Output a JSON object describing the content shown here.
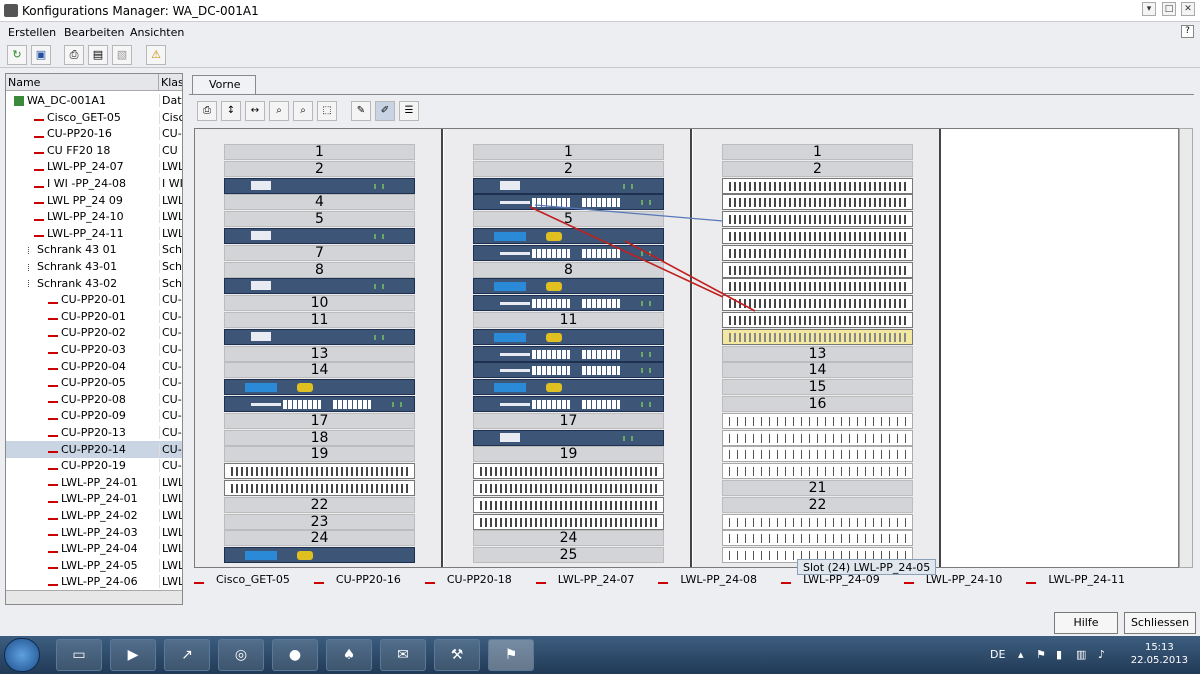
{
  "window": {
    "title": "Konfigurations Manager: WA_DC-001A1"
  },
  "menu": {
    "erstellen": "Erstellen",
    "bearbeiten": "Bearbeiten",
    "ansichten": "Ansichten",
    "help": "?"
  },
  "tree": {
    "col_name": "Name",
    "col_class": "Klas",
    "rows": [
      {
        "name": "WA_DC-001A1",
        "cls": "Dato"
      },
      {
        "name": "Cisco_GET-05",
        "cls": "Cisco"
      },
      {
        "name": "CU-PP20-16",
        "cls": "CU-"
      },
      {
        "name": "CU FF20 18",
        "cls": "CU"
      },
      {
        "name": "LWL-PP_24-07",
        "cls": "LWL"
      },
      {
        "name": "I WI -PP_24-08",
        "cls": "I WI"
      },
      {
        "name": "LWL PP_24 09",
        "cls": "LWL"
      },
      {
        "name": "LWL-PP_24-10",
        "cls": "LWL"
      },
      {
        "name": "LWL-PP_24-11",
        "cls": "LWL"
      },
      {
        "name": "Schrank 43 01",
        "cls": "Schr"
      },
      {
        "name": "Schrank 43-01",
        "cls": "Schr"
      },
      {
        "name": "Schrank 43-02",
        "cls": "Schr"
      },
      {
        "name": "CU-PP20-01",
        "cls": "CU-"
      },
      {
        "name": "CU-PP20-01",
        "cls": "CU-"
      },
      {
        "name": "CU-PP20-02",
        "cls": "CU-"
      },
      {
        "name": "CU-PP20-03",
        "cls": "CU-"
      },
      {
        "name": "CU-PP20-04",
        "cls": "CU-"
      },
      {
        "name": "CU-PP20-05",
        "cls": "CU-"
      },
      {
        "name": "CU-PP20-08",
        "cls": "CU-"
      },
      {
        "name": "CU-PP20-09",
        "cls": "CU-"
      },
      {
        "name": "CU-PP20-13",
        "cls": "CU-"
      },
      {
        "name": "CU-PP20-14",
        "cls": "CU-"
      },
      {
        "name": "CU-PP20-19",
        "cls": "CU-"
      },
      {
        "name": "LWL-PP_24-01",
        "cls": "LWL"
      },
      {
        "name": "LWL-PP_24-01",
        "cls": "LWL"
      },
      {
        "name": "LWL-PP_24-02",
        "cls": "LWL"
      },
      {
        "name": "LWL-PP_24-03",
        "cls": "LWL"
      },
      {
        "name": "LWL-PP_24-04",
        "cls": "LWL"
      },
      {
        "name": "LWL-PP_24-05",
        "cls": "LWL"
      },
      {
        "name": "LWL-PP_24-06",
        "cls": "LWL"
      }
    ]
  },
  "view": {
    "tab_label": "Vorne"
  },
  "racks": {
    "r1": {
      "1": "1",
      "2": "2",
      "4": "4",
      "5": "5",
      "7": "7",
      "8": "8",
      "10": "10",
      "11": "11",
      "13": "13",
      "14": "14",
      "17": "17",
      "18": "18",
      "19": "19",
      "22": "22",
      "23": "23",
      "24": "24"
    },
    "r2": {
      "1": "1",
      "2": "2",
      "5": "5",
      "8": "8",
      "11": "11",
      "17": "17",
      "19": "19",
      "24": "24",
      "25": "25"
    },
    "r3": {
      "1": "1",
      "2": "2",
      "13": "13",
      "14": "14",
      "15": "15",
      "16": "16",
      "21": "21",
      "22": "22"
    }
  },
  "tooltip": "Slot (24) LWL-PP_24-05",
  "statusbar": {
    "items": [
      "Cisco_GET-05",
      "CU-PP20-16",
      "CU-PP20-18",
      "LWL-PP_24-07",
      "LWL-PP_24-08",
      "LWL-PP_24-09",
      "LWL-PP_24-10",
      "LWL-PP_24-11"
    ]
  },
  "buttons": {
    "hilfe": "Hilfe",
    "schliessen": "Schliessen"
  },
  "taskbar": {
    "lang": "DE",
    "time": "15:13",
    "date": "22.05.2013"
  }
}
